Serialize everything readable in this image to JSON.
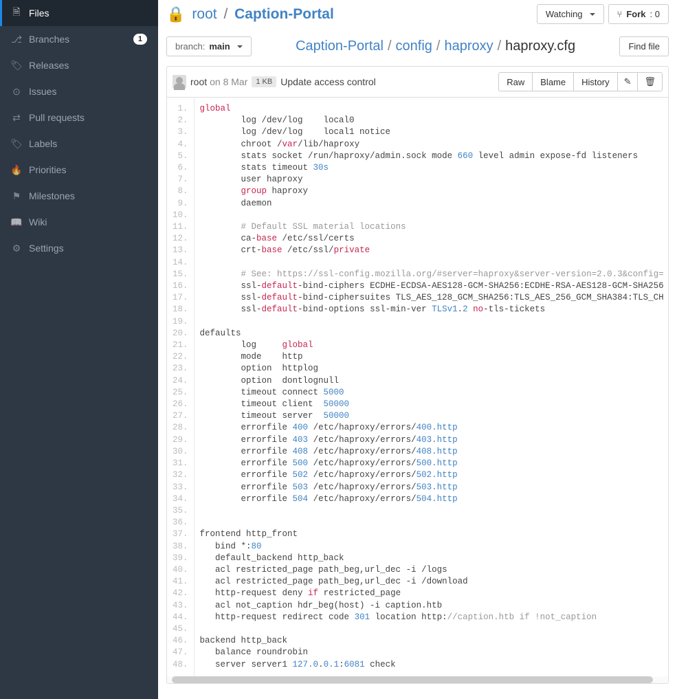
{
  "sidebar": {
    "items": [
      {
        "icon": "🗎",
        "label": "Files",
        "active": true
      },
      {
        "icon": "⎇",
        "label": "Branches",
        "badge": "1"
      },
      {
        "icon": "🏷",
        "label": "Releases"
      },
      {
        "icon": "⊙",
        "label": "Issues"
      },
      {
        "icon": "⇄",
        "label": "Pull requests"
      },
      {
        "icon": "🏷",
        "label": "Labels"
      },
      {
        "icon": "🔥",
        "label": "Priorities"
      },
      {
        "icon": "⚑",
        "label": "Milestones"
      },
      {
        "icon": "📖",
        "label": "Wiki"
      },
      {
        "icon": "⚙",
        "label": "Settings"
      }
    ]
  },
  "repo": {
    "owner": "root",
    "name": "Caption-Portal",
    "lock": "🔒"
  },
  "actions": {
    "watching": "Watching",
    "fork": "Fork",
    "fork_count": ": 0"
  },
  "branch": {
    "prefix": "branch: ",
    "name": "main"
  },
  "path": {
    "segments": [
      "Caption-Portal",
      "config",
      "haproxy"
    ],
    "file": "haproxy.cfg",
    "find": "Find file"
  },
  "commit": {
    "author": "root",
    "date": "on 8 Mar",
    "size": "1 KB",
    "message": "Update access control",
    "raw": "Raw",
    "blame": "Blame",
    "history": "History",
    "edit": "✎",
    "del": "🗑"
  },
  "code": [
    [
      [
        "kw",
        "global"
      ]
    ],
    [
      [
        "p",
        "        log /dev/log    local0"
      ]
    ],
    [
      [
        "p",
        "        log /dev/log    local1 notice"
      ]
    ],
    [
      [
        "p",
        "        chroot /"
      ],
      [
        "kw",
        "var"
      ],
      [
        "p",
        "/lib/haproxy"
      ]
    ],
    [
      [
        "p",
        "        stats socket /run/haproxy/admin.sock mode "
      ],
      [
        "num",
        "660"
      ],
      [
        "p",
        " level admin expose-fd listeners"
      ]
    ],
    [
      [
        "p",
        "        stats timeout "
      ],
      [
        "num",
        "30s"
      ]
    ],
    [
      [
        "p",
        "        user haproxy"
      ]
    ],
    [
      [
        "p",
        "        "
      ],
      [
        "kw",
        "group"
      ],
      [
        "p",
        " haproxy"
      ]
    ],
    [
      [
        "p",
        "        daemon"
      ]
    ],
    [
      [
        "p",
        ""
      ]
    ],
    [
      [
        "p",
        "        "
      ],
      [
        "cmt",
        "# Default SSL material locations"
      ]
    ],
    [
      [
        "p",
        "        ca-"
      ],
      [
        "kw",
        "base"
      ],
      [
        "p",
        " /etc/ssl/certs"
      ]
    ],
    [
      [
        "p",
        "        crt-"
      ],
      [
        "kw",
        "base"
      ],
      [
        "p",
        " /etc/ssl/"
      ],
      [
        "kw",
        "private"
      ]
    ],
    [
      [
        "p",
        ""
      ]
    ],
    [
      [
        "p",
        "        "
      ],
      [
        "cmt",
        "# See: https://ssl-config.mozilla.org/#server=haproxy&server-version=2.0.3&config="
      ]
    ],
    [
      [
        "p",
        "        ssl-"
      ],
      [
        "kw",
        "default"
      ],
      [
        "p",
        "-bind-ciphers ECDHE-ECDSA-AES128-GCM-SHA256:ECDHE-RSA-AES128-GCM-SHA256"
      ]
    ],
    [
      [
        "p",
        "        ssl-"
      ],
      [
        "kw",
        "default"
      ],
      [
        "p",
        "-bind-ciphersuites TLS_AES_128_GCM_SHA256:TLS_AES_256_GCM_SHA384:TLS_CH"
      ]
    ],
    [
      [
        "p",
        "        ssl-"
      ],
      [
        "kw",
        "default"
      ],
      [
        "p",
        "-bind-options ssl-min-ver "
      ],
      [
        "num",
        "TLSv1"
      ],
      [
        "p",
        "."
      ],
      [
        "num",
        "2"
      ],
      [
        "p",
        " "
      ],
      [
        "kw",
        "no"
      ],
      [
        "p",
        "-tls-tickets"
      ]
    ],
    [
      [
        "p",
        ""
      ]
    ],
    [
      [
        "p",
        "defaults"
      ]
    ],
    [
      [
        "p",
        "        log     "
      ],
      [
        "kw",
        "global"
      ]
    ],
    [
      [
        "p",
        "        mode    http"
      ]
    ],
    [
      [
        "p",
        "        option  httplog"
      ]
    ],
    [
      [
        "p",
        "        option  dontlognull"
      ]
    ],
    [
      [
        "p",
        "        timeout connect "
      ],
      [
        "num",
        "5000"
      ]
    ],
    [
      [
        "p",
        "        timeout client  "
      ],
      [
        "num",
        "50000"
      ]
    ],
    [
      [
        "p",
        "        timeout server  "
      ],
      [
        "num",
        "50000"
      ]
    ],
    [
      [
        "p",
        "        errorfile "
      ],
      [
        "num",
        "400"
      ],
      [
        "p",
        " /etc/haproxy/errors/"
      ],
      [
        "num",
        "400.http"
      ]
    ],
    [
      [
        "p",
        "        errorfile "
      ],
      [
        "num",
        "403"
      ],
      [
        "p",
        " /etc/haproxy/errors/"
      ],
      [
        "num",
        "403.http"
      ]
    ],
    [
      [
        "p",
        "        errorfile "
      ],
      [
        "num",
        "408"
      ],
      [
        "p",
        " /etc/haproxy/errors/"
      ],
      [
        "num",
        "408.http"
      ]
    ],
    [
      [
        "p",
        "        errorfile "
      ],
      [
        "num",
        "500"
      ],
      [
        "p",
        " /etc/haproxy/errors/"
      ],
      [
        "num",
        "500.http"
      ]
    ],
    [
      [
        "p",
        "        errorfile "
      ],
      [
        "num",
        "502"
      ],
      [
        "p",
        " /etc/haproxy/errors/"
      ],
      [
        "num",
        "502.http"
      ]
    ],
    [
      [
        "p",
        "        errorfile "
      ],
      [
        "num",
        "503"
      ],
      [
        "p",
        " /etc/haproxy/errors/"
      ],
      [
        "num",
        "503.http"
      ]
    ],
    [
      [
        "p",
        "        errorfile "
      ],
      [
        "num",
        "504"
      ],
      [
        "p",
        " /etc/haproxy/errors/"
      ],
      [
        "num",
        "504.http"
      ]
    ],
    [
      [
        "p",
        ""
      ]
    ],
    [
      [
        "p",
        ""
      ]
    ],
    [
      [
        "p",
        "frontend http_front"
      ]
    ],
    [
      [
        "p",
        "   bind *:"
      ],
      [
        "num",
        "80"
      ]
    ],
    [
      [
        "p",
        "   default_backend http_back"
      ]
    ],
    [
      [
        "p",
        "   acl restricted_page path_beg,url_dec -i /logs"
      ]
    ],
    [
      [
        "p",
        "   acl restricted_page path_beg,url_dec -i /download"
      ]
    ],
    [
      [
        "p",
        "   http-request deny "
      ],
      [
        "kw",
        "if"
      ],
      [
        "p",
        " restricted_page"
      ]
    ],
    [
      [
        "p",
        "   acl not_caption hdr_beg(host) -i caption.htb"
      ]
    ],
    [
      [
        "p",
        "   http-request redirect code "
      ],
      [
        "num",
        "301"
      ],
      [
        "p",
        " location http:"
      ],
      [
        "cmt",
        "//caption.htb if !not_caption"
      ]
    ],
    [
      [
        "p",
        ""
      ]
    ],
    [
      [
        "p",
        "backend http_back"
      ]
    ],
    [
      [
        "p",
        "   balance roundrobin"
      ]
    ],
    [
      [
        "p",
        "   server server1 "
      ],
      [
        "num",
        "127.0"
      ],
      [
        "p",
        "."
      ],
      [
        "num",
        "0.1"
      ],
      [
        "p",
        ":"
      ],
      [
        "num",
        "6081"
      ],
      [
        "p",
        " check"
      ]
    ]
  ]
}
